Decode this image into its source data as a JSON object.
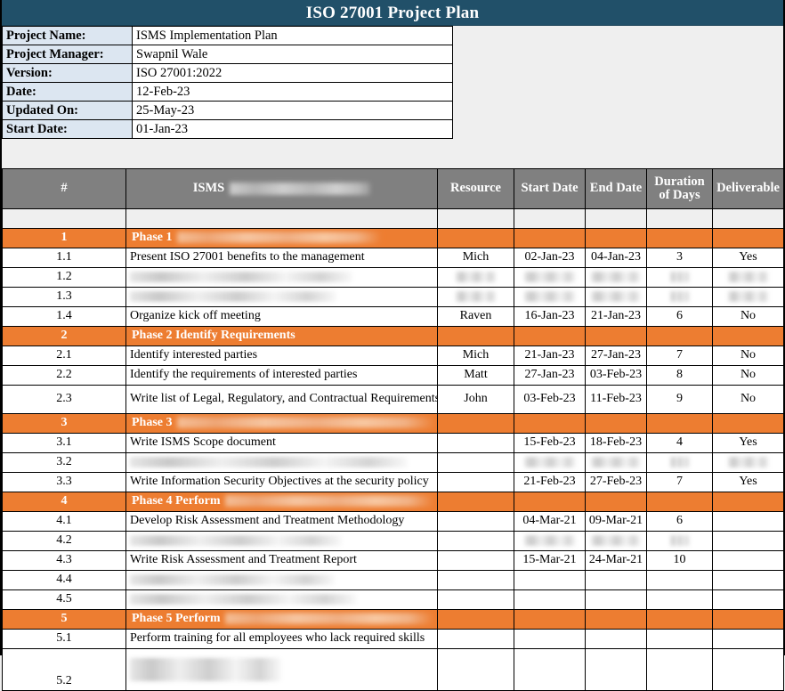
{
  "document": {
    "title": "ISO 27001 Project Plan",
    "colors": {
      "title_bar": "#215069",
      "label_cell": "#DCE6F1",
      "table_header": "#808080",
      "phase_row": "#ED7D31",
      "page_background": "#EFEFEF"
    }
  },
  "info": {
    "rows": [
      {
        "label": "Project Name:",
        "value": "ISMS Implementation Plan"
      },
      {
        "label": "Project Manager:",
        "value": "Swapnil Wale"
      },
      {
        "label": "Version:",
        "value": "ISO 27001:2022"
      },
      {
        "label": "Date:",
        "value": "12-Feb-23"
      },
      {
        "label": "Updated On:",
        "value": "25-May-23"
      },
      {
        "label": "Start Date:",
        "value": "01-Jan-23"
      }
    ]
  },
  "plan": {
    "headers": {
      "num": "#",
      "task": "ISMS",
      "task_redacted": true,
      "resource": "Resource",
      "start_date": "Start Date",
      "end_date": "End Date",
      "duration": "Duration of Days",
      "deliverable": "Deliverable"
    },
    "rows": [
      {
        "kind": "phase",
        "num": "1",
        "task": "Phase 1",
        "task_redacted": true,
        "resource": "",
        "start_date": "",
        "end_date": "",
        "duration": "",
        "deliverable": ""
      },
      {
        "kind": "task",
        "num": "1.1",
        "task": "Present ISO 27001 benefits to the management",
        "resource": "Mich",
        "start_date": "02-Jan-23",
        "end_date": "04-Jan-23",
        "duration": "3",
        "deliverable": "Yes"
      },
      {
        "kind": "task",
        "num": "1.2",
        "task": "",
        "task_redacted": true,
        "resource": "",
        "resource_redacted": true,
        "start_date": "",
        "start_date_redacted": true,
        "end_date": "",
        "end_date_redacted": true,
        "duration": "",
        "duration_redacted": true,
        "deliverable": "",
        "deliverable_redacted": true
      },
      {
        "kind": "task",
        "num": "1.3",
        "task": "",
        "task_redacted": true,
        "resource": "",
        "resource_redacted": true,
        "start_date": "",
        "start_date_redacted": true,
        "end_date": "",
        "end_date_redacted": true,
        "duration": "",
        "duration_redacted": true,
        "deliverable": "",
        "deliverable_redacted": true
      },
      {
        "kind": "task",
        "num": "1.4",
        "task": "Organize kick off meeting",
        "resource": "Raven",
        "start_date": "16-Jan-23",
        "end_date": "21-Jan-23",
        "duration": "6",
        "deliverable": "No"
      },
      {
        "kind": "phase",
        "num": "2",
        "task": "Phase 2 Identify Requirements",
        "resource": "",
        "start_date": "",
        "end_date": "",
        "duration": "",
        "deliverable": ""
      },
      {
        "kind": "task",
        "num": "2.1",
        "task": "Identify interested parties",
        "resource": "Mich",
        "start_date": "21-Jan-23",
        "end_date": "27-Jan-23",
        "duration": "7",
        "deliverable": "No"
      },
      {
        "kind": "task",
        "num": "2.2",
        "task": "Identify the requirements of interested parties",
        "resource": "Matt",
        "start_date": "27-Jan-23",
        "end_date": "03-Feb-23",
        "duration": "8",
        "deliverable": "No"
      },
      {
        "kind": "task",
        "num": "2.3",
        "task": "Write list of Legal, Regulatory, and Contractual Requirements",
        "resource": "John",
        "start_date": "03-Feb-23",
        "end_date": "11-Feb-23",
        "duration": "9",
        "deliverable": "No",
        "tall": true
      },
      {
        "kind": "phase",
        "num": "3",
        "task": "Phase 3",
        "task_redacted": true,
        "resource": "",
        "start_date": "",
        "end_date": "",
        "duration": "",
        "deliverable": ""
      },
      {
        "kind": "task",
        "num": "3.1",
        "task": "Write ISMS Scope document",
        "resource": "",
        "start_date": "15-Feb-23",
        "end_date": "18-Feb-23",
        "duration": "4",
        "deliverable": "Yes"
      },
      {
        "kind": "task",
        "num": "3.2",
        "task": "",
        "task_redacted": true,
        "resource": "",
        "start_date": "",
        "start_date_redacted": true,
        "end_date": "",
        "end_date_redacted": true,
        "duration": "",
        "duration_redacted": true,
        "deliverable": "",
        "deliverable_redacted": true
      },
      {
        "kind": "task",
        "num": "3.3",
        "task": "Write Information Security Objectives at the security policy",
        "resource": "",
        "start_date": "21-Feb-23",
        "end_date": "27-Feb-23",
        "duration": "7",
        "deliverable": "Yes"
      },
      {
        "kind": "phase",
        "num": "4",
        "task": "Phase 4 Perform",
        "task_redacted": true,
        "resource": "",
        "start_date": "",
        "end_date": "",
        "duration": "",
        "deliverable": ""
      },
      {
        "kind": "task",
        "num": "4.1",
        "task": "Develop Risk Assessment and Treatment Methodology",
        "resource": "",
        "start_date": "04-Mar-21",
        "end_date": "09-Mar-21",
        "duration": "6",
        "deliverable": ""
      },
      {
        "kind": "task",
        "num": "4.2",
        "task": "",
        "task_redacted": true,
        "resource": "",
        "start_date": "",
        "start_date_redacted": true,
        "end_date": "",
        "end_date_redacted": true,
        "duration": "",
        "duration_redacted": true,
        "deliverable": ""
      },
      {
        "kind": "task",
        "num": "4.3",
        "task": "Write Risk Assessment and Treatment Report",
        "resource": "",
        "start_date": "15-Mar-21",
        "end_date": "24-Mar-21",
        "duration": "10",
        "deliverable": ""
      },
      {
        "kind": "task",
        "num": "4.4",
        "task": "",
        "task_redacted": true,
        "resource": "",
        "start_date": "",
        "end_date": "",
        "duration": "",
        "deliverable": ""
      },
      {
        "kind": "task",
        "num": "4.5",
        "task": "",
        "task_redacted": true,
        "resource": "",
        "start_date": "",
        "end_date": "",
        "duration": "",
        "deliverable": ""
      },
      {
        "kind": "phase",
        "num": "5",
        "task": "Phase 5 Perform",
        "task_redacted": true,
        "resource": "",
        "start_date": "",
        "end_date": "",
        "duration": "",
        "deliverable": ""
      },
      {
        "kind": "task",
        "num": "5.1",
        "task": "Perform training for all employees who lack required skills",
        "resource": "",
        "start_date": "",
        "end_date": "",
        "duration": "",
        "deliverable": ""
      },
      {
        "kind": "task",
        "num": "5.2",
        "task": "",
        "task_redacted": true,
        "task_redacted_lines": 2,
        "resource": "",
        "start_date": "",
        "end_date": "",
        "duration": "",
        "deliverable": "",
        "xtall": true
      }
    ]
  }
}
